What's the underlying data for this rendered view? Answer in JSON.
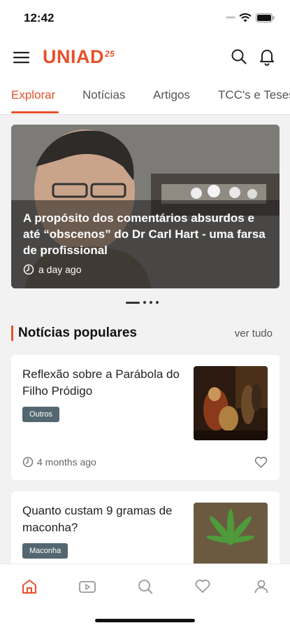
{
  "status_bar": {
    "time": "12:42"
  },
  "header": {
    "logo_text": "UNIAD",
    "logo_sup": "25",
    "brand_color": "#e6512a"
  },
  "tabs": [
    {
      "label": "Explorar",
      "active": true
    },
    {
      "label": "Notícias",
      "active": false
    },
    {
      "label": "Artigos",
      "active": false
    },
    {
      "label": "TCC's e Teses",
      "active": false
    }
  ],
  "hero": {
    "title": "A propósito dos comentários absurdos e até “obscenos” do Dr Carl Hart - uma farsa de profissional",
    "time": "a day ago",
    "clock_icon": "clock-icon"
  },
  "section": {
    "title": "Notícias populares",
    "see_all": "ver tudo"
  },
  "cards": [
    {
      "title": "Reflexão sobre a Parábola do Filho Pródigo",
      "tag": "Outros",
      "time": "4 months ago"
    },
    {
      "title": "Quanto custam 9 gramas de maconha?",
      "tag": "Maconha"
    }
  ],
  "bottom_nav": [
    {
      "icon": "home-icon",
      "active": true
    },
    {
      "icon": "video-icon",
      "active": false
    },
    {
      "icon": "search-icon",
      "active": false
    },
    {
      "icon": "heart-icon",
      "active": false
    },
    {
      "icon": "profile-icon",
      "active": false
    }
  ]
}
